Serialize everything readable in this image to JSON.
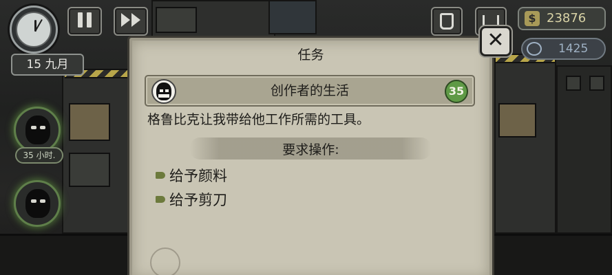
{
  "hud": {
    "date_day": "15",
    "date_month": "九月",
    "money": "23876",
    "money_symbol": "$",
    "tokens": "1425",
    "pause_icon": "pause-icon",
    "fast_forward_icon": "fast-forward-icon",
    "inventory_icon": "bag-icon",
    "shop_icon": "cart-icon"
  },
  "characters": [
    {
      "timer": "35 小时."
    },
    {
      "timer": ""
    }
  ],
  "dialog": {
    "title": "任务",
    "quest": {
      "name": "创作者的生活",
      "reward": "35"
    },
    "description": "格鲁比克让我带给他工作所需的工具。",
    "requirements_title": "要求操作:",
    "requirements": [
      "给予颜料",
      "给予剪刀"
    ],
    "close_label": "✕"
  },
  "colors": {
    "panel_bg": "#c9c5b4",
    "quest_bar_bg": "#a9a591",
    "reward_badge": "#5f9a46",
    "money_text": "#d9d3a6",
    "token_text": "#9fb1c4"
  }
}
